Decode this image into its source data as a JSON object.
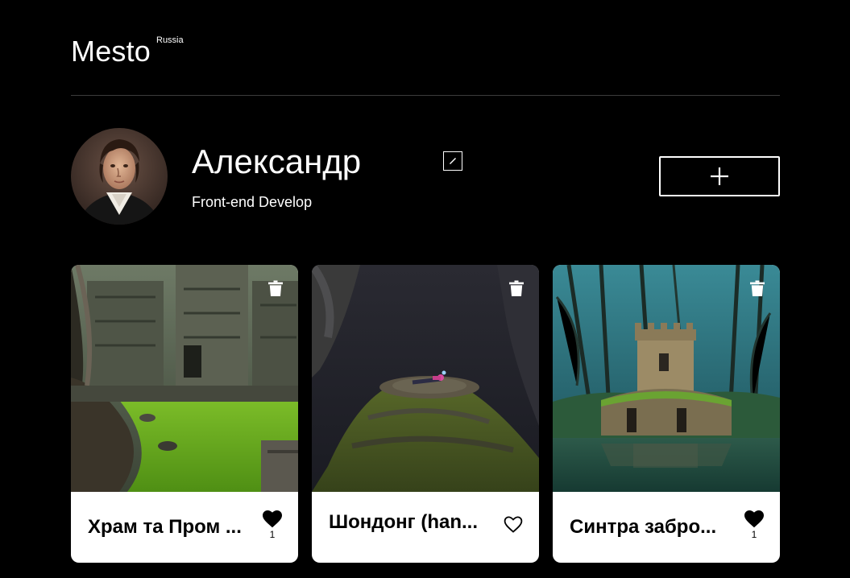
{
  "header": {
    "logo": "Mesto",
    "logo_sub": "Russia"
  },
  "profile": {
    "name": "Александр",
    "job": "Front-end Develop",
    "edit_icon": "pencil-icon",
    "add_icon": "plus-icon"
  },
  "cards": [
    {
      "title": "Храм та Пром ...",
      "liked": true,
      "likes": "1",
      "image": "jungle temple with green pond"
    },
    {
      "title": "Шондонг (han...",
      "liked": false,
      "likes": "",
      "image": "person lying on mossy rock in cave"
    },
    {
      "title": "Синтра забро...",
      "liked": true,
      "likes": "1",
      "image": "abandoned tower by lake in misty forest"
    }
  ],
  "colors": {
    "background": "#000000",
    "card": "#ffffff",
    "divider": "#545454"
  }
}
